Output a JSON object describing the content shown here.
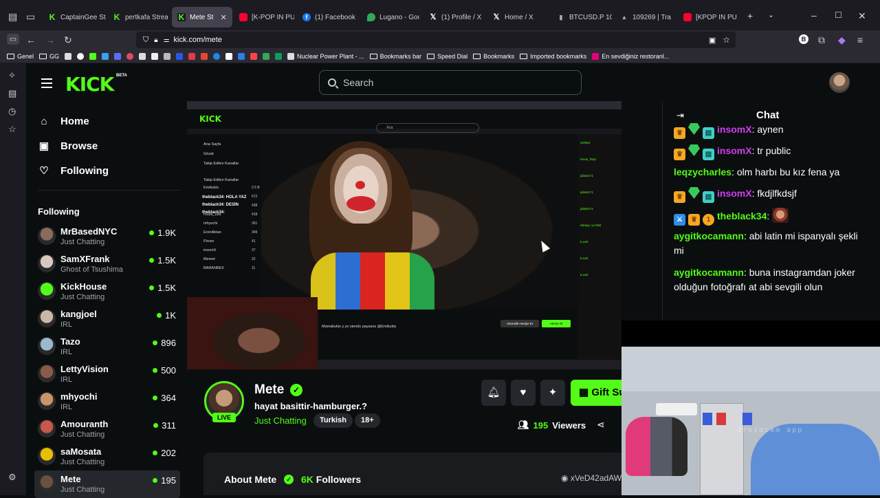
{
  "browser": {
    "tabs": [
      {
        "label": "CaptainGee Str",
        "icon": "kick"
      },
      {
        "label": "pertkafa Stream",
        "icon": "kick"
      },
      {
        "label": "Mete St",
        "icon": "kick",
        "active": true
      },
      {
        "label": "[K-POP IN PUB",
        "icon": "youtube"
      },
      {
        "label": "(1) Facebook",
        "icon": "facebook"
      },
      {
        "label": "Lugano - Goog",
        "icon": "maps"
      },
      {
        "label": "(1) Profile / X",
        "icon": "x"
      },
      {
        "label": "Home / X",
        "icon": "x"
      },
      {
        "label": "BTCUSD.P 109,",
        "icon": "tradingview"
      },
      {
        "label": "109269 | Tra",
        "icon": "tradingview"
      },
      {
        "label": "[KPOP IN PUBL",
        "icon": "youtube"
      }
    ],
    "url": "kick.com/mete",
    "bookmarks": {
      "genel": "Genel",
      "gg": "GG",
      "nuclear": "Nuclear Power Plant - ...",
      "bar": "Bookmarks bar",
      "speed": "Speed Dial",
      "bookmarks": "Bookmarks",
      "imported": "Imported bookmarks",
      "restoran": "En sevdiğiniz restoranl..."
    }
  },
  "header": {
    "logo": "KICK",
    "beta": "BETA",
    "search_placeholder": "Search"
  },
  "nav": {
    "home": "Home",
    "browse": "Browse",
    "following": "Following"
  },
  "following": {
    "title": "Following",
    "items": [
      {
        "name": "MrBasedNYC",
        "category": "Just Chatting",
        "viewers": "1.9K",
        "color": "#8a6a5a"
      },
      {
        "name": "SamXFrank",
        "category": "Ghost of Tsushima",
        "viewers": "1.5K",
        "color": "#d8c8c0"
      },
      {
        "name": "KickHouse",
        "category": "Just Chatting",
        "viewers": "1.5K",
        "color": "#53fc18"
      },
      {
        "name": "kangjoel",
        "category": "IRL",
        "viewers": "1K",
        "color": "#c9b8a8"
      },
      {
        "name": "Tazo",
        "category": "IRL",
        "viewers": "896",
        "color": "#9ab8d0"
      },
      {
        "name": "LettyVision",
        "category": "IRL",
        "viewers": "500",
        "color": "#8a5a48"
      },
      {
        "name": "mhyochi",
        "category": "IRL",
        "viewers": "364",
        "color": "#c9946a"
      },
      {
        "name": "Amouranth",
        "category": "Just Chatting",
        "viewers": "311",
        "color": "#c8584a"
      },
      {
        "name": "saMosata",
        "category": "Just Chatting",
        "viewers": "202",
        "color": "#e5c000"
      },
      {
        "name": "Mete",
        "category": "Just Chatting",
        "viewers": "195",
        "color": "#6a5040",
        "active": true
      }
    ]
  },
  "video": {
    "inner_logo": "KICK",
    "inner_search": "Ara",
    "sidebar_lines": [
      "Ana Sayfa",
      "Gözat",
      "Takip Edilen Kanallar",
      "Takip Edilen Kanallar"
    ],
    "overlay_lines": [
      "theblack34: HOLA YAZ",
      "theblack34: DESİN",
      "theblack34:"
    ],
    "channels": [
      {
        "name": "Emikukis",
        "n": "2.5 B"
      },
      {
        "name": "",
        "n": "572"
      },
      {
        "name": "",
        "n": "438"
      },
      {
        "name": "musa_usa",
        "n": "418"
      },
      {
        "name": "mhyochi",
        "n": "361"
      },
      {
        "name": "ErenAktan",
        "n": "349"
      },
      {
        "name": "Fhoes",
        "n": "41"
      },
      {
        "name": "insomX",
        "n": "37"
      },
      {
        "name": "Memet",
        "n": "22"
      },
      {
        "name": "BARANBEX",
        "n": "11"
      }
    ],
    "inner_title": "Mamakukis y yo siendo payasos @Emikukis",
    "inner_follow": "Abone Ol",
    "inner_sub": "Abonelik Hediye Et",
    "inner_chat": [
      "Sohbet",
      "Kevin_Rojo",
      "juliani171",
      "juliani171",
      "juliani171",
      "Sleepy: yo EMI",
      "ILuxE",
      "ILuxE",
      "ILuxE"
    ]
  },
  "channel": {
    "name": "Mete",
    "title": "hayat basittir-hamburger.?",
    "category": "Just Chatting",
    "tags": [
      "Turkish",
      "18+"
    ],
    "live": "LIVE",
    "gift_label": "Gift Su",
    "viewers": "195",
    "viewers_label": "Viewers"
  },
  "about": {
    "title": "About Mete",
    "followers": "6K",
    "followers_label": "Followers",
    "discord": "xVeD42adAW"
  },
  "chat": {
    "title": "Chat",
    "messages": [
      {
        "user": "insomX",
        "text": "aynen",
        "color": "#d03cf0",
        "badges": [
          "crown",
          "gem",
          "gift"
        ]
      },
      {
        "user": "insomX",
        "text": "tr public",
        "color": "#d03cf0",
        "badges": [
          "crown",
          "gem",
          "gift"
        ]
      },
      {
        "user": "leqzycharles",
        "text": "olm harbı bu kız fena ya",
        "color": "#53fc18",
        "badges": []
      },
      {
        "user": "insomX",
        "text": "fkdjlfkdsjf",
        "color": "#d03cf0",
        "badges": [
          "crown",
          "gem",
          "gift"
        ]
      },
      {
        "user": "theblack34",
        "text": "",
        "color": "#53fc18",
        "badges": [
          "mod",
          "crown",
          "sub"
        ],
        "emote": true
      },
      {
        "user": "aygitkocamann",
        "text": "abi latin mi ispanyalı şekli mi",
        "color": "#53fc18",
        "badges": []
      },
      {
        "user": "aygitkocamann",
        "text": "buna instagramdan joker olduğun fotoğrafı at abi sevgili olun",
        "color": "#53fc18",
        "badges": []
      }
    ],
    "sub_badge": "1"
  },
  "webcam": {
    "watermark": "droidcam app"
  },
  "colors": {
    "accent": "#53fc18",
    "bg": "#0b0e0f",
    "surface": "#24272c"
  }
}
